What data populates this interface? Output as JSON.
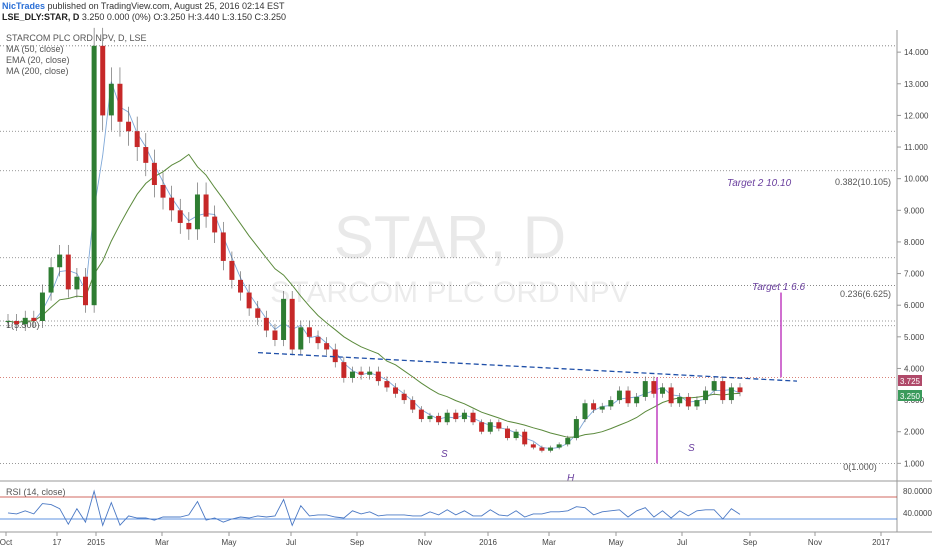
{
  "header": {
    "author": "NicTrades",
    "published": "published on TradingView.com, August 25, 2016 02:14 EST",
    "symbol": "LSE_DLY:STAR, D",
    "quote": "3.250 0.000 (0%) O:3.250 H:3.440 L:3.150 C:3.250"
  },
  "watermark": {
    "symbol": "STAR, D",
    "name": "STARCOM PLC ORD NPV"
  },
  "chart_data": {
    "type": "candlestick",
    "title": "STARCOM PLC ORD NPV, D, LSE",
    "indicators": [
      "MA (50, close)",
      "EMA (20, close)",
      "MA (200, close)"
    ],
    "x_ticks": [
      "Oct",
      "17",
      "2015",
      "Mar",
      "May",
      "Jul",
      "Sep",
      "Nov",
      "2016",
      "Mar",
      "May",
      "Jul",
      "Sep",
      "Nov",
      "2017"
    ],
    "y_ticks": [
      "1.000",
      "2.000",
      "3.000",
      "4.000",
      "5.000",
      "6.000",
      "7.000",
      "8.000",
      "9.000",
      "10.000",
      "11.000",
      "12.000",
      "13.000",
      "14.000"
    ],
    "y_range": [
      0.6,
      14.7
    ],
    "price_labels": {
      "upper": "3.725",
      "last": "3.250"
    },
    "fib_levels": [
      {
        "label": "0(1.000)",
        "value": 1.0
      },
      {
        "label": "0.236(6.625)",
        "value": 6.625
      },
      {
        "label": "0.382(10.105)",
        "value": 10.105
      },
      {
        "label": "1(5.500)",
        "value": 5.5
      }
    ],
    "annotations": [
      {
        "text": "Target 1 6.6"
      },
      {
        "text": "Target 2  10.10"
      },
      {
        "text": "S"
      },
      {
        "text": "H"
      },
      {
        "text": "S"
      }
    ],
    "neckline_start": 4.5,
    "neckline_end": 3.6,
    "price_series": [
      [
        "Oct",
        5.5
      ],
      [
        "Oct",
        5.4
      ],
      [
        "Oct",
        5.6
      ],
      [
        "17",
        5.5
      ],
      [
        "17",
        6.4
      ],
      [
        "17",
        7.2
      ],
      [
        "17",
        7.6
      ],
      [
        "17",
        6.5
      ],
      [
        "17",
        6.9
      ],
      [
        "17",
        6.0
      ],
      [
        "2015",
        14.2
      ],
      [
        "2015",
        12.0
      ],
      [
        "2015",
        13.0
      ],
      [
        "2015",
        11.8
      ],
      [
        "2015",
        11.5
      ],
      [
        "2015",
        11.0
      ],
      [
        "2015",
        10.5
      ],
      [
        "2015",
        9.8
      ],
      [
        "Mar",
        9.4
      ],
      [
        "Mar",
        9.0
      ],
      [
        "Mar",
        8.6
      ],
      [
        "Mar",
        8.4
      ],
      [
        "Mar",
        9.5
      ],
      [
        "Mar",
        8.8
      ],
      [
        "Mar",
        8.3
      ],
      [
        "Mar",
        7.4
      ],
      [
        "May",
        6.8
      ],
      [
        "May",
        6.4
      ],
      [
        "May",
        5.9
      ],
      [
        "May",
        5.6
      ],
      [
        "May",
        5.2
      ],
      [
        "May",
        4.9
      ],
      [
        "May",
        6.2
      ],
      [
        "May",
        4.6
      ],
      [
        "Jul",
        5.3
      ],
      [
        "Jul",
        5.0
      ],
      [
        "Jul",
        4.8
      ],
      [
        "Jul",
        4.6
      ],
      [
        "Jul",
        4.2
      ],
      [
        "Jul",
        3.7
      ],
      [
        "Jul",
        3.9
      ],
      [
        "Sep",
        3.8
      ],
      [
        "Sep",
        3.9
      ],
      [
        "Sep",
        3.6
      ],
      [
        "Sep",
        3.4
      ],
      [
        "Sep",
        3.2
      ],
      [
        "Sep",
        3.0
      ],
      [
        "Sep",
        2.7
      ],
      [
        "Nov",
        2.4
      ],
      [
        "Nov",
        2.5
      ],
      [
        "Nov",
        2.3
      ],
      [
        "Nov",
        2.6
      ],
      [
        "Nov",
        2.4
      ],
      [
        "Nov",
        2.6
      ],
      [
        "Nov",
        2.3
      ],
      [
        "2016",
        2.0
      ],
      [
        "2016",
        2.3
      ],
      [
        "2016",
        2.1
      ],
      [
        "2016",
        1.8
      ],
      [
        "2016",
        2.0
      ],
      [
        "2016",
        1.6
      ],
      [
        "2016",
        1.5
      ],
      [
        "Mar",
        1.4
      ],
      [
        "Mar",
        1.5
      ],
      [
        "Mar",
        1.6
      ],
      [
        "Mar",
        1.8
      ],
      [
        "Mar",
        2.4
      ],
      [
        "Mar",
        2.9
      ],
      [
        "Mar",
        2.7
      ],
      [
        "May",
        2.8
      ],
      [
        "May",
        3.0
      ],
      [
        "May",
        3.3
      ],
      [
        "May",
        2.9
      ],
      [
        "May",
        3.1
      ],
      [
        "May",
        3.6
      ],
      [
        "May",
        3.2
      ],
      [
        "Jul",
        3.4
      ],
      [
        "Jul",
        2.9
      ],
      [
        "Jul",
        3.1
      ],
      [
        "Jul",
        2.8
      ],
      [
        "Jul",
        3.0
      ],
      [
        "Jul",
        3.3
      ],
      [
        "Jul",
        3.6
      ],
      [
        "Sep",
        3.0
      ],
      [
        "Sep",
        3.4
      ],
      [
        "Sep",
        3.25
      ]
    ],
    "rsi": {
      "label": "RSI (14, close)",
      "y_ticks": [
        "80.0000",
        "40.0000"
      ]
    }
  }
}
